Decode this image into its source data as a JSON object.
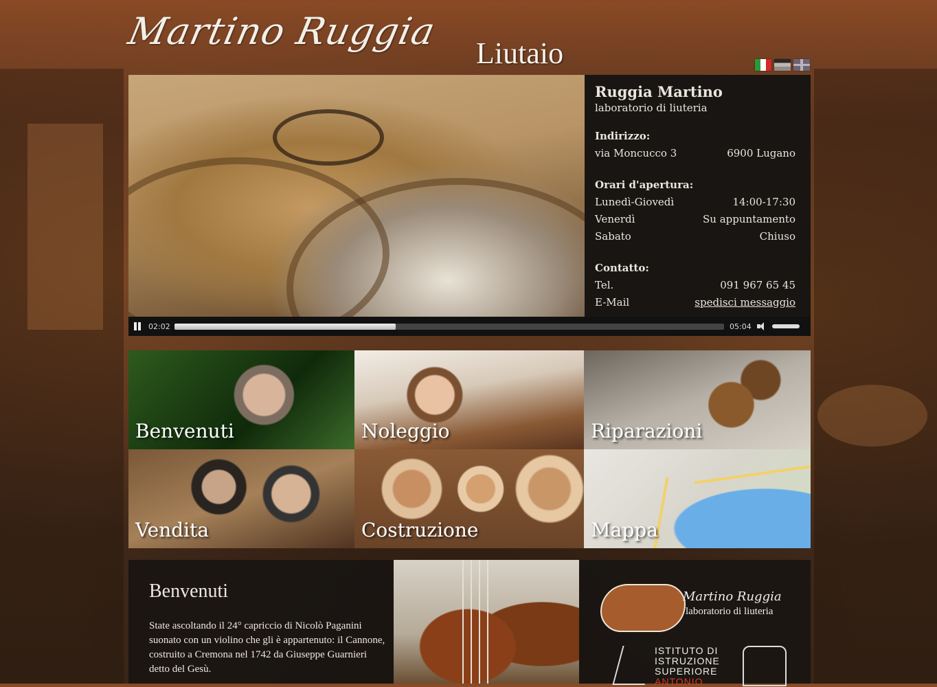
{
  "header": {
    "logo_script": "Martino Ruggia",
    "logo_word": "Liutaio",
    "languages": [
      "it-flag-icon",
      "de-flag-icon",
      "en-flag-icon"
    ]
  },
  "info": {
    "name": "Ruggia Martino",
    "subtitle": "laboratorio di liuteria",
    "address_heading": "Indirizzo:",
    "street": "via Moncucco 3",
    "city": "6900 Lugano",
    "hours_heading": "Orari d'apertura:",
    "hours": [
      {
        "day": "Lunedì-Giovedì",
        "time": "14:00-17:30"
      },
      {
        "day": "Venerdì",
        "time": "Su appuntamento"
      },
      {
        "day": "Sabato",
        "time": "Chiuso"
      }
    ],
    "contact_heading": "Contatto:",
    "tel_label": "Tel.",
    "tel_value": "091 967 65 45",
    "email_label": "E-Mail",
    "email_link": "spedisci messaggio"
  },
  "player": {
    "current_time": "02:02",
    "total_time": "05:04",
    "progress": 0.402,
    "volume": 1.0
  },
  "tiles": [
    {
      "label": "Benvenuti"
    },
    {
      "label": "Noleggio"
    },
    {
      "label": "Riparazioni"
    },
    {
      "label": "Vendita"
    },
    {
      "label": "Costruzione"
    },
    {
      "label": "Mappa"
    }
  ],
  "welcome": {
    "title": "Benvenuti",
    "text": "State ascoltando il 24° capriccio di Nicolò Paganini suonato con un violino che gli è appartenuto: il Cannone, costruito a Cremona nel 1742 da Giuseppe Guarnieri detto del Gesù."
  },
  "brand": {
    "script": "Martino Ruggia",
    "subtitle": "laboratorio di liuteria"
  },
  "institute": {
    "line1": "ISTITUTO DI",
    "line2": "ISTRUZIONE",
    "line3": "SUPERIORE",
    "line4": "ANTONIO"
  }
}
